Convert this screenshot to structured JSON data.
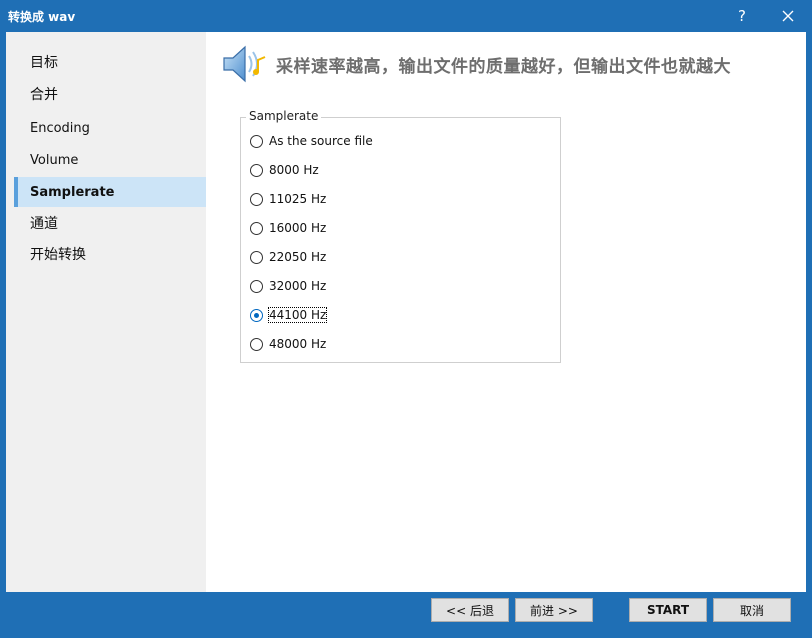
{
  "window": {
    "title": "转换成 wav",
    "help_label": "?"
  },
  "sidebar": {
    "items": [
      {
        "label": "目标"
      },
      {
        "label": "合并"
      },
      {
        "label": "Encoding"
      },
      {
        "label": "Volume"
      },
      {
        "label": "Samplerate"
      },
      {
        "label": "通道"
      },
      {
        "label": "开始转换"
      }
    ],
    "selected": "Samplerate"
  },
  "header": {
    "text": "采样速率越高，输出文件的质量越好，但输出文件也就越大",
    "icon": "speaker-icon"
  },
  "samplerate_group": {
    "legend": "Samplerate",
    "options": [
      {
        "label": "As the source file",
        "checked": false
      },
      {
        "label": "8000 Hz",
        "checked": false
      },
      {
        "label": "11025 Hz",
        "checked": false
      },
      {
        "label": "16000 Hz",
        "checked": false
      },
      {
        "label": "22050 Hz",
        "checked": false
      },
      {
        "label": "32000 Hz",
        "checked": false
      },
      {
        "label": "44100 Hz",
        "checked": true
      },
      {
        "label": "48000 Hz",
        "checked": false
      }
    ]
  },
  "footer": {
    "back_label": "<< 后退",
    "next_label": "前进 >>",
    "start_label": "START",
    "cancel_label": "取消"
  },
  "colors": {
    "accent": "#1f6fb5",
    "selected_bg": "#cce4f7",
    "radio_checked": "#0067c0"
  }
}
